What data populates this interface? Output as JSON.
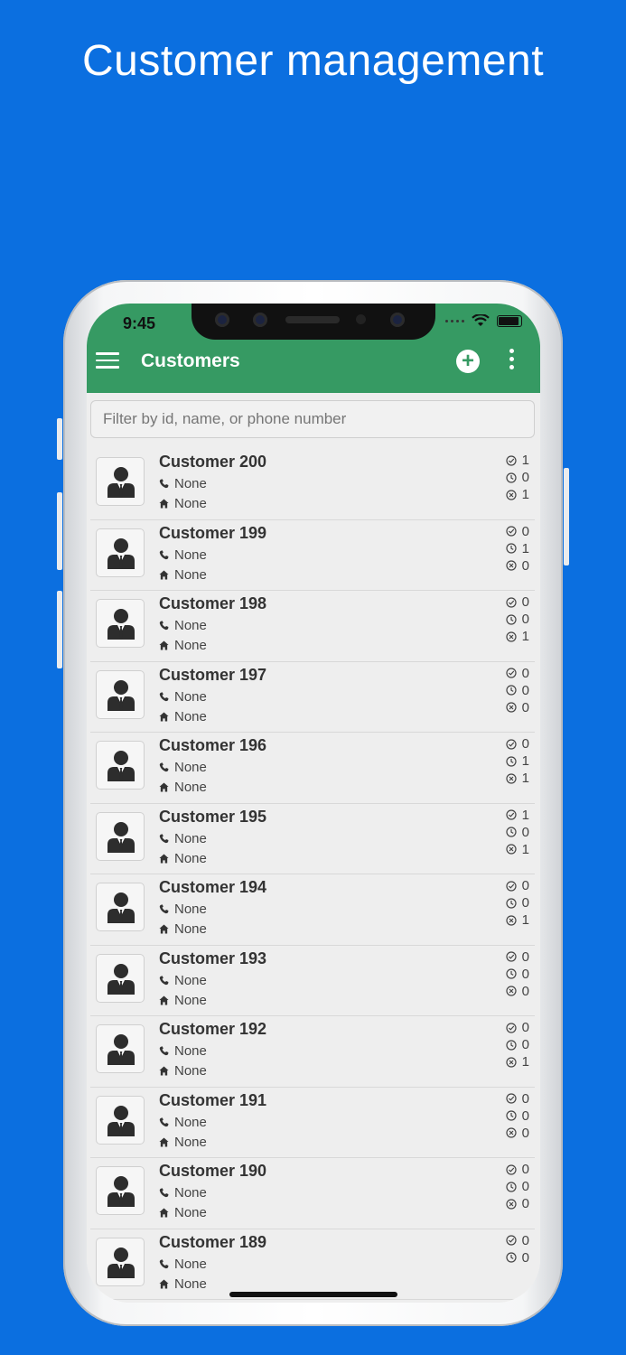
{
  "headline": "Customer management",
  "status": {
    "time": "9:45"
  },
  "appbar": {
    "title": "Customers",
    "add_icon": "plus-circle-icon",
    "more_icon": "more-vert-icon",
    "menu_icon": "hamburger-menu-icon"
  },
  "search": {
    "placeholder": "Filter by id, name, or phone number",
    "value": ""
  },
  "colors": {
    "background": "#0b6fe0",
    "appbar": "#369a63"
  },
  "customers": [
    {
      "name": "Customer 200",
      "phone": "None",
      "address": "None",
      "completed": "1",
      "pending": "0",
      "cancelled": "1"
    },
    {
      "name": "Customer 199",
      "phone": "None",
      "address": "None",
      "completed": "0",
      "pending": "1",
      "cancelled": "0"
    },
    {
      "name": "Customer 198",
      "phone": "None",
      "address": "None",
      "completed": "0",
      "pending": "0",
      "cancelled": "1"
    },
    {
      "name": "Customer 197",
      "phone": "None",
      "address": "None",
      "completed": "0",
      "pending": "0",
      "cancelled": "0"
    },
    {
      "name": "Customer 196",
      "phone": "None",
      "address": "None",
      "completed": "0",
      "pending": "1",
      "cancelled": "1"
    },
    {
      "name": "Customer 195",
      "phone": "None",
      "address": "None",
      "completed": "1",
      "pending": "0",
      "cancelled": "1"
    },
    {
      "name": "Customer 194",
      "phone": "None",
      "address": "None",
      "completed": "0",
      "pending": "0",
      "cancelled": "1"
    },
    {
      "name": "Customer 193",
      "phone": "None",
      "address": "None",
      "completed": "0",
      "pending": "0",
      "cancelled": "0"
    },
    {
      "name": "Customer 192",
      "phone": "None",
      "address": "None",
      "completed": "0",
      "pending": "0",
      "cancelled": "1"
    },
    {
      "name": "Customer 191",
      "phone": "None",
      "address": "None",
      "completed": "0",
      "pending": "0",
      "cancelled": "0"
    },
    {
      "name": "Customer 190",
      "phone": "None",
      "address": "None",
      "completed": "0",
      "pending": "0",
      "cancelled": "0"
    },
    {
      "name": "Customer 189",
      "phone": "None",
      "address": "None",
      "completed": "0",
      "pending": "0",
      "cancelled": ""
    }
  ]
}
